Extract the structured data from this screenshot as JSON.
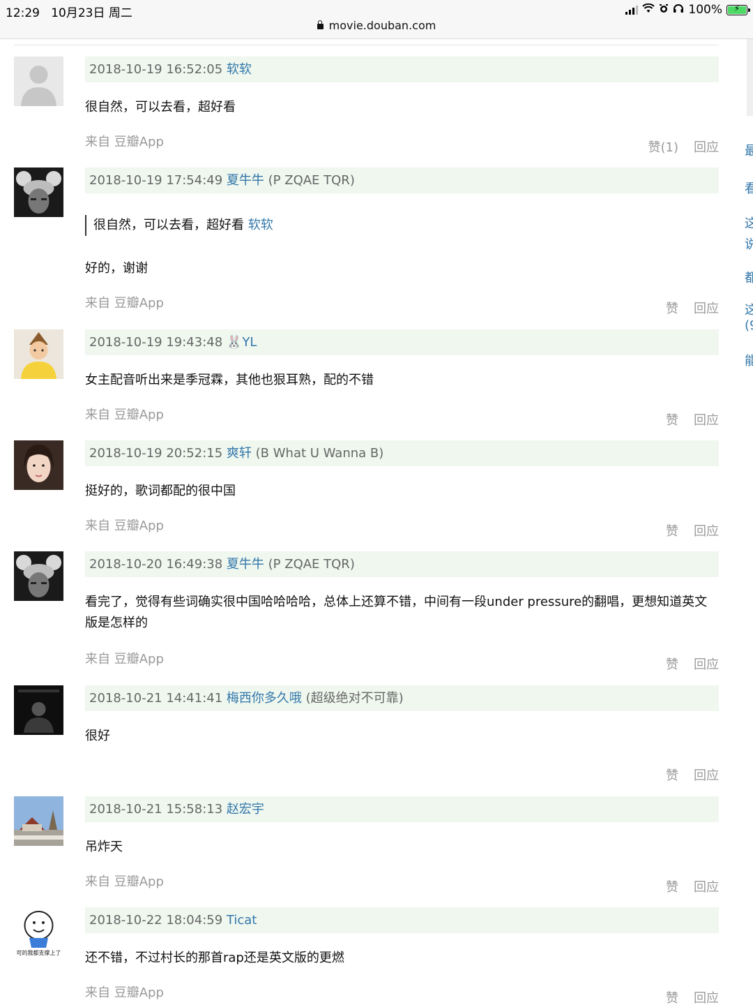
{
  "status_bar": {
    "time": "12:29",
    "date": "10月23日 周二",
    "battery": "100%",
    "url": "movie.douban.com"
  },
  "comments": [
    {
      "time": "2018-10-19 16:52:05",
      "user": "软软",
      "nick": "",
      "quote": "",
      "quote_user": "",
      "text": "很自然，可以去看，超好看",
      "source": "来自 豆瓣App",
      "like": "赞(1)",
      "reply": "回应",
      "avatar": "grey-placeholder"
    },
    {
      "time": "2018-10-19 17:54:49",
      "user": "夏牛牛",
      "nick": "(P ZQAE TQR)",
      "quote": "很自然，可以去看，超好看 ",
      "quote_user": "软软",
      "text": "好的，谢谢",
      "source": "来自 豆瓣App",
      "like": "赞",
      "reply": "回应",
      "avatar": "mouse-ears-dark"
    },
    {
      "time": "2018-10-19 19:43:48",
      "user": "🐰YL",
      "nick": "",
      "quote": "",
      "quote_user": "",
      "text": "女主配音听出来是季冠霖，其他也狠耳熟，配的不错",
      "source": "来自 豆瓣App",
      "like": "赞",
      "reply": "回应",
      "avatar": "child-yellow"
    },
    {
      "time": "2018-10-19 20:52:15",
      "user": "爽轩",
      "nick": "(B What U Wanna B)",
      "quote": "",
      "quote_user": "",
      "text": "挺好的，歌词都配的很中国",
      "source": "来自 豆瓣App",
      "like": "赞",
      "reply": "回应",
      "avatar": "girl-portrait"
    },
    {
      "time": "2018-10-20 16:49:38",
      "user": "夏牛牛",
      "nick": "(P ZQAE TQR)",
      "quote": "",
      "quote_user": "",
      "text": "看完了，觉得有些词确实很中国哈哈哈哈，总体上还算不错，中间有一段under pressure的翻唱，更想知道英文版是怎样的",
      "source": "来自 豆瓣App",
      "like": "赞",
      "reply": "回应",
      "avatar": "mouse-ears-dark"
    },
    {
      "time": "2018-10-21 14:41:41",
      "user": "梅西你多久哦",
      "nick": "(超级绝对不可靠)",
      "quote": "",
      "quote_user": "",
      "text": "很好",
      "source": "",
      "like": "赞",
      "reply": "回应",
      "avatar": "dark-figure"
    },
    {
      "time": "2018-10-21 15:58:13",
      "user": "赵宏宇",
      "nick": "",
      "quote": "",
      "quote_user": "",
      "text": "吊炸天",
      "source": "来自 豆瓣App",
      "like": "赞",
      "reply": "回应",
      "avatar": "house-landscape"
    },
    {
      "time": "2018-10-22 18:04:59",
      "user": "Ticat",
      "nick": "",
      "quote": "",
      "quote_user": "",
      "text": "还不错，不过村长的那首rap还是英文版的更燃",
      "source": "来自 豆瓣App",
      "like": "赞",
      "reply": "回应",
      "avatar": "cartoon-sticker",
      "avatar_caption": "可的我都支撑上了"
    }
  ],
  "right_sidebar_fragments": [
    "最",
    "看",
    "这",
    "说",
    "都",
    "这",
    "(9",
    "能"
  ],
  "colors": {
    "link": "#3377aa",
    "header_bg": "#eff7ef",
    "muted": "#999999"
  }
}
